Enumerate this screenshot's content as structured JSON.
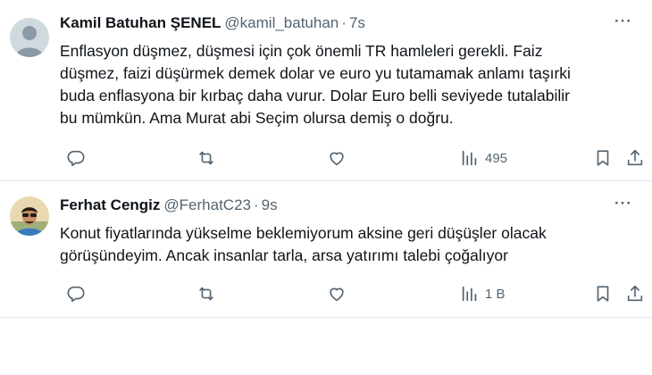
{
  "tweets": [
    {
      "author_name": "Kamil Batuhan ŞENEL",
      "handle": "@kamil_batuhan",
      "separator": "·",
      "time": "7s",
      "more_label": "···",
      "lines": [
        "Enflasyon düşmez, düşmesi için çok önemli TR hamleleri gerekli. Faiz",
        "düşmez, faizi düşürmek demek dolar ve euro yu tutamamak anlamı taşırki",
        "buda enflasyona bir kırbaç daha vurur. Dolar Euro belli seviyede tutalabilir",
        "bu mümkün. Ama Murat abi Seçim olursa demiş o doğru."
      ],
      "views": "495",
      "avatar_icon": "default-profile-icon"
    },
    {
      "author_name": "Ferhat Cengiz",
      "handle": "@FerhatC23",
      "separator": "·",
      "time": "9s",
      "more_label": "···",
      "lines": [
        "Konut fiyatlarında yükselme beklemiyorum aksine geri düşüşler olacak",
        "görüşündeyim. Ancak insanlar tarla, arsa yatırımı talebi çoğalıyor"
      ],
      "views": "1 B",
      "avatar_icon": "profile-photo"
    }
  ],
  "colors": {
    "text_primary": "#0f1419",
    "text_secondary": "#536471",
    "divider": "#e6e9ec",
    "avatar_default_bg": "#cfd9de"
  },
  "icons": [
    "reply-icon",
    "retweet-icon",
    "like-icon",
    "views-icon",
    "bookmark-icon",
    "share-icon"
  ]
}
